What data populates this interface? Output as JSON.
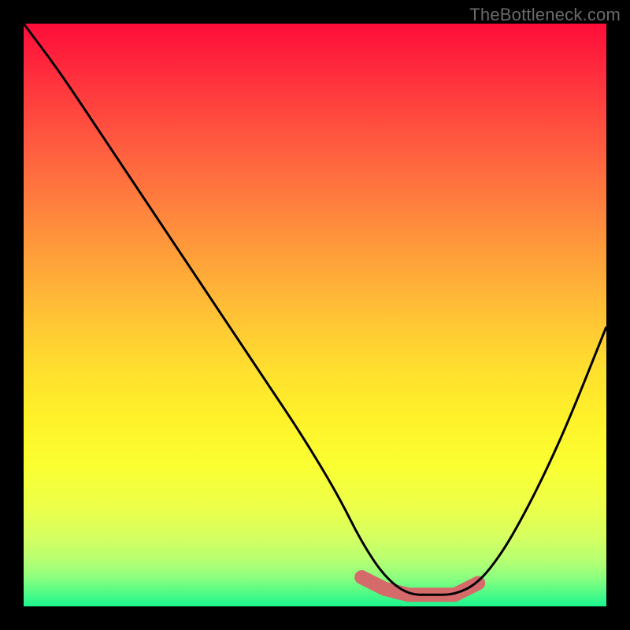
{
  "watermark": "TheBottleneck.com",
  "colors": {
    "background": "#000000",
    "curve": "#000000",
    "highlight": "#d46a6a"
  },
  "chart_data": {
    "type": "line",
    "title": "",
    "xlabel": "",
    "ylabel": "",
    "xlim": [
      0,
      100
    ],
    "ylim": [
      0,
      100
    ],
    "grid": false,
    "legend": false,
    "note": "values estimated from pixel positions; y near 0 = bottom (best match), y near 100 = top (worst)",
    "series": [
      {
        "name": "bottleneck-curve",
        "x": [
          0,
          6,
          12,
          18,
          24,
          30,
          36,
          42,
          48,
          54,
          58,
          62,
          66,
          70,
          74,
          78,
          82,
          86,
          90,
          94,
          100
        ],
        "y": [
          100,
          92,
          83,
          74,
          65,
          56,
          47,
          38,
          29,
          19,
          11,
          5,
          2,
          2,
          2,
          4,
          9,
          16,
          24,
          33,
          48
        ]
      },
      {
        "name": "optimal-range-highlight",
        "x": [
          58,
          62,
          66,
          70,
          74,
          78
        ],
        "y": [
          5,
          3,
          2,
          2,
          2,
          4
        ]
      }
    ]
  }
}
